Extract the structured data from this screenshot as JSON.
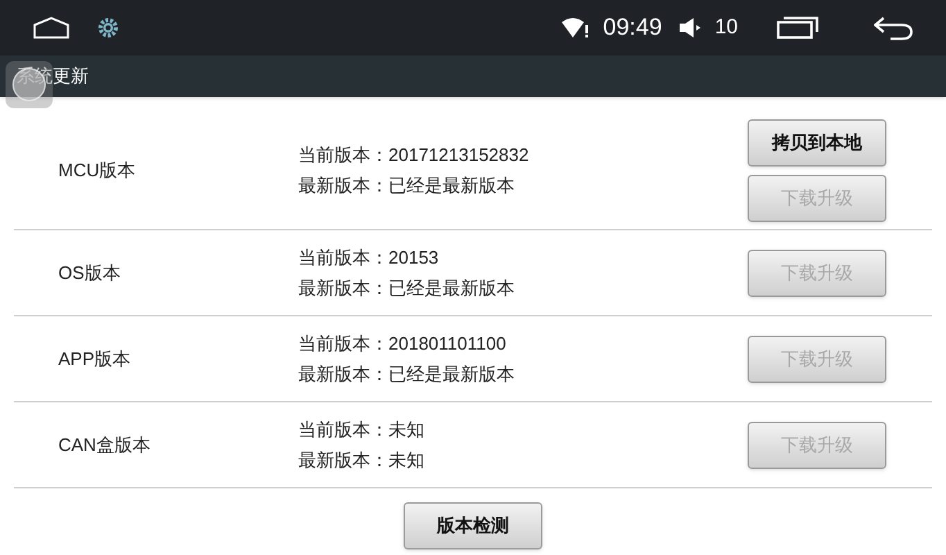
{
  "status_bar": {
    "time": "09:49",
    "volume": "10"
  },
  "title": "系统更新",
  "rows": [
    {
      "name": "MCU版本",
      "current": "当前版本：20171213152832",
      "latest": "最新版本：已经是最新版本",
      "buttons": [
        {
          "label": "拷贝到本地",
          "disabled": false
        },
        {
          "label": "下载升级",
          "disabled": true
        }
      ]
    },
    {
      "name": "OS版本",
      "current": "当前版本：20153",
      "latest": "最新版本：已经是最新版本",
      "buttons": [
        {
          "label": "下载升级",
          "disabled": true
        }
      ]
    },
    {
      "name": "APP版本",
      "current": "当前版本：201801101100",
      "latest": "最新版本：已经是最新版本",
      "buttons": [
        {
          "label": "下载升级",
          "disabled": true
        }
      ]
    },
    {
      "name": "CAN盒版本",
      "current": "当前版本：未知",
      "latest": "最新版本：未知",
      "buttons": [
        {
          "label": "下载升级",
          "disabled": true
        }
      ]
    }
  ],
  "check_button": {
    "label": "版本检测",
    "disabled": false
  }
}
